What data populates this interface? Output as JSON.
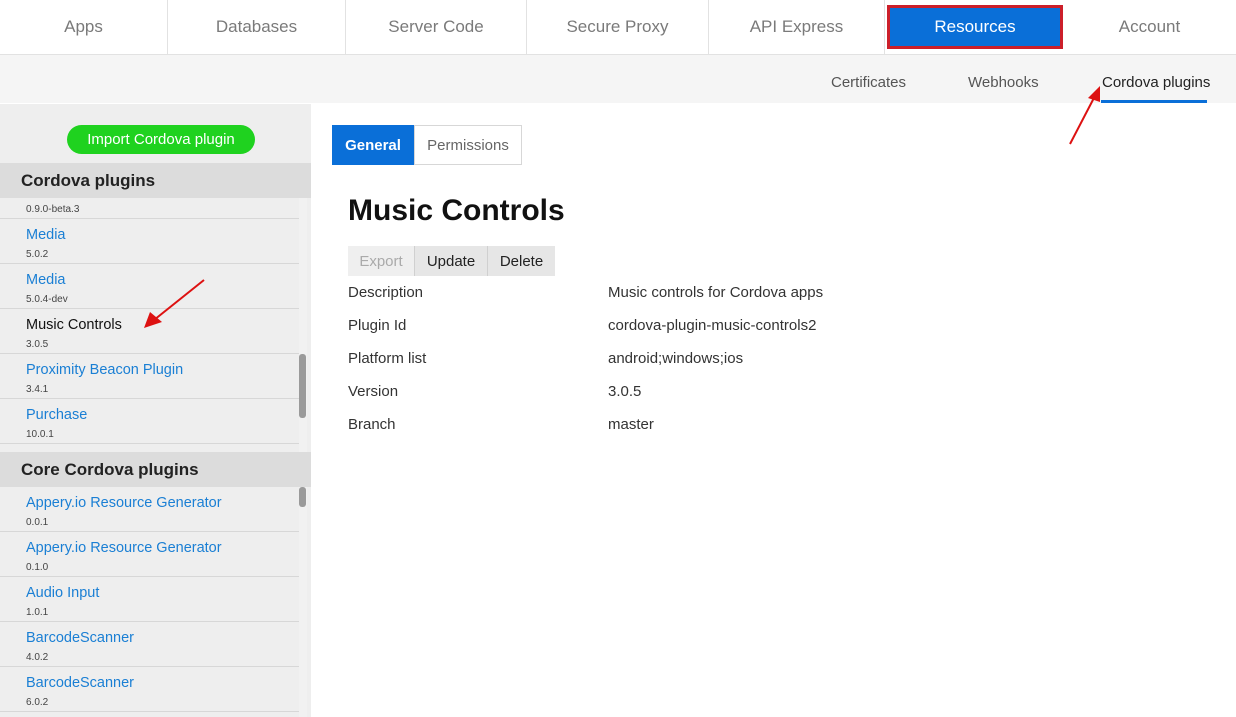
{
  "topnav": {
    "tabs": [
      {
        "label": "Apps",
        "active": false
      },
      {
        "label": "Databases",
        "active": false
      },
      {
        "label": "Server Code",
        "active": false
      },
      {
        "label": "Secure Proxy",
        "active": false
      },
      {
        "label": "API Express",
        "active": false
      },
      {
        "label": "Resources",
        "active": true
      },
      {
        "label": "Account",
        "active": false
      }
    ]
  },
  "subnav": {
    "items": [
      {
        "label": "Certificates"
      },
      {
        "label": "Webhooks"
      },
      {
        "label": "Cordova plugins",
        "active": true
      }
    ]
  },
  "sidebar": {
    "import_label": "Import Cordova plugin",
    "cordova_header": "Cordova plugins",
    "cordova_items": [
      {
        "name": "",
        "version": "0.9.0-beta.3"
      },
      {
        "name": "Media",
        "version": "5.0.2"
      },
      {
        "name": "Media",
        "version": "5.0.4-dev"
      },
      {
        "name": "Music Controls",
        "version": "3.0.5",
        "selected": true
      },
      {
        "name": "Proximity Beacon Plugin",
        "version": "3.4.1"
      },
      {
        "name": "Purchase",
        "version": "10.0.1"
      }
    ],
    "core_header": "Core Cordova plugins",
    "core_items": [
      {
        "name": "Appery.io Resource Generator",
        "version": "0.0.1"
      },
      {
        "name": "Appery.io Resource Generator",
        "version": "0.1.0"
      },
      {
        "name": "Audio Input",
        "version": "1.0.1"
      },
      {
        "name": "BarcodeScanner",
        "version": "4.0.2"
      },
      {
        "name": "BarcodeScanner",
        "version": "6.0.2"
      }
    ]
  },
  "main": {
    "tabs": [
      {
        "label": "General",
        "active": true
      },
      {
        "label": "Permissions",
        "active": false
      }
    ],
    "title": "Music Controls",
    "actions": {
      "export": "Export",
      "update": "Update",
      "delete": "Delete"
    },
    "props": [
      {
        "key": "Description",
        "value": "Music controls for Cordova apps"
      },
      {
        "key": "Plugin Id",
        "value": "cordova-plugin-music-controls2"
      },
      {
        "key": "Platform list",
        "value": "android;windows;ios"
      },
      {
        "key": "Version",
        "value": "3.0.5"
      },
      {
        "key": "Branch",
        "value": "master"
      }
    ]
  },
  "colors": {
    "accent": "#0a6fd8",
    "highlight_border": "#cc1f2a",
    "import_button": "#1fd21f",
    "link": "#1a7fd4",
    "annotation_arrow": "#dd1111"
  }
}
